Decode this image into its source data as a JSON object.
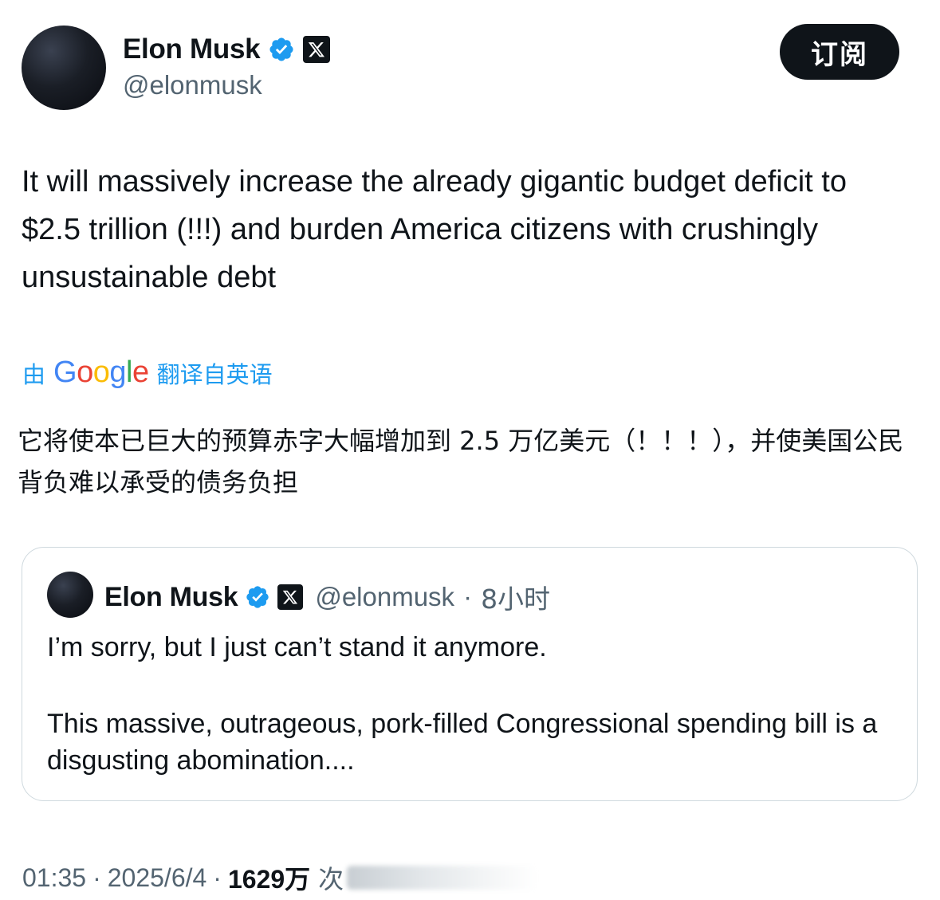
{
  "author": {
    "name": "Elon Musk",
    "handle": "@elonmusk"
  },
  "subscribe_label": "订阅",
  "tweet_text": "It will massively increase the already gigantic budget deficit to $2.5 trillion (!!!) and burden America citizens with crushingly unsustainable debt",
  "translation": {
    "by": "由",
    "provider": "Google",
    "label": "翻译自英语",
    "text": "它将使本已巨大的预算赤字大幅增加到 2.5 万亿美元（！！！），并使美国公民背负难以承受的债务负担"
  },
  "quote": {
    "name": "Elon Musk",
    "handle": "@elonmusk",
    "sep": "·",
    "time": "8小时",
    "line1": "I’m sorry, but I just can’t stand it anymore.",
    "line2": "This massive, outrageous, pork-filled Congressional spending bill is a disgusting abomination...."
  },
  "footer": {
    "time": "01:35",
    "sep1": "·",
    "date": "2025/6/4",
    "sep2": "·",
    "views": "1629万",
    "views_label": "次"
  },
  "colors": {
    "verified": "#1d9bf0",
    "link": "#1d9bf0",
    "secondary": "#536471",
    "primary": "#0f1419"
  },
  "icons": {
    "verified": "verified-badge-icon",
    "x_affiliation": "x-logo-icon"
  }
}
